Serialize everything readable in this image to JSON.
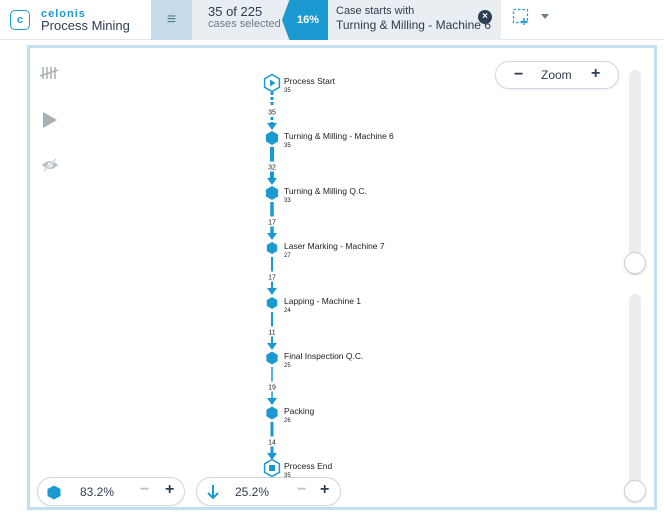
{
  "brand": {
    "logo_letter": "c",
    "name": "celonis",
    "product": "Process Mining"
  },
  "selection": {
    "count_text": "35 of 225",
    "sub_text": "cases selected",
    "percent": "16%"
  },
  "filter": {
    "line1": "Case starts with",
    "line2": "Turning & Milling - Machine 6"
  },
  "zoom": {
    "label": "Zoom",
    "minus": "−",
    "plus": "+"
  },
  "activity_slider": {
    "value": "83.2%",
    "minus": "−",
    "plus": "+"
  },
  "connection_slider": {
    "value": "25.2%",
    "minus": "−",
    "plus": "+"
  },
  "process": {
    "start": {
      "label": "Process Start",
      "count": "35"
    },
    "end": {
      "label": "Process End",
      "count": "35"
    },
    "activities": [
      {
        "label": "Turning & Milling - Machine 6",
        "count": "35"
      },
      {
        "label": "Turning & Milling Q.C.",
        "count": "33"
      },
      {
        "label": "Laser Marking - Machine 7",
        "count": "27"
      },
      {
        "label": "Lapping - Machine 1",
        "count": "24"
      },
      {
        "label": "Final Inspection Q.C.",
        "count": "25"
      },
      {
        "label": "Packing",
        "count": "26"
      }
    ],
    "connections": [
      "35",
      "32",
      "17",
      "17",
      "11",
      "19",
      "14"
    ]
  },
  "colors": {
    "accent": "#1b9ad1",
    "panel_bg": "#e9eef2",
    "menu_bg": "#c7dceb",
    "text": "#2c3e50"
  },
  "icons": {
    "logo": "celonis-logo-icon",
    "menu": "hamburger-icon",
    "close": "close-circle-icon",
    "selection": "selection-frame-icon",
    "dropdown": "chevron-down-icon",
    "tools": [
      "tally-marks-icon",
      "play-icon",
      "eye-slash-icon"
    ],
    "activity": "hexagon-icon",
    "connection": "arrow-down-icon"
  }
}
